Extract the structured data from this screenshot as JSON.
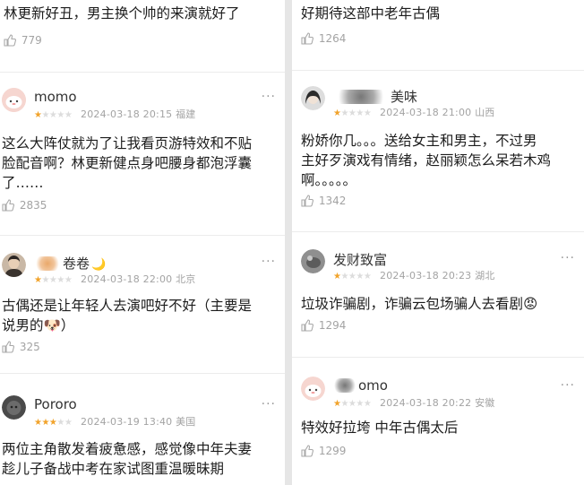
{
  "left": {
    "top": {
      "text": "林更新好丑，男主换个帅的来演就好了",
      "likes": "779"
    },
    "reviews": [
      {
        "username": "momo",
        "stars": 1,
        "date": "2024-03-18 20:15",
        "location": "福建",
        "lines": [
          "这么大阵仗就为了让我看页游特效和不贴",
          "脸配音啊？林更新健点身吧腰身都泡浮囊",
          "了……"
        ],
        "likes": "2835"
      },
      {
        "username": "卷卷",
        "emoji": "🌙",
        "stars": 1,
        "date": "2024-03-18 22:00",
        "location": "北京",
        "lines": [
          "古偶还是让年轻人去演吧好不好（主要是",
          "说男的🐶）"
        ],
        "likes": "325"
      },
      {
        "username": "Pororo",
        "stars": 3,
        "date": "2024-03-19 13:40",
        "location": "美国",
        "lines": [
          "两位主角散发着疲惫感，感觉像中年夫妻",
          "趁儿子备战中考在家试图重温暖昧期"
        ]
      }
    ]
  },
  "right": {
    "top": {
      "text": "好期待这部中老年古偶",
      "likes": "1264"
    },
    "reviews": [
      {
        "username": "美味",
        "stars": 1,
        "date": "2024-03-18 21:00",
        "location": "山西",
        "lines": [
          "粉娇你几。。。送给女主和男主，不过男",
          "主好歹演戏有情绪，赵丽颖怎么呆若木鸡",
          "啊。。。。。"
        ],
        "likes": "1342"
      },
      {
        "username": "发财致富",
        "stars": 1,
        "date": "2024-03-18 20:23",
        "location": "湖北",
        "lines": [
          "垃圾诈骗剧，诈骗云包场骗人去看剧😡"
        ],
        "likes": "1294"
      },
      {
        "username": "omo",
        "stars": 1,
        "date": "2024-03-18 20:22",
        "location": "安徽",
        "lines": [
          "特效好拉垮 中年古偶太后"
        ],
        "likes": "1299"
      }
    ]
  },
  "more_label": "···",
  "colors": {
    "star_on": "#f1a32b",
    "star_off": "#dcdcdc",
    "meta": "#a3a3a3"
  }
}
